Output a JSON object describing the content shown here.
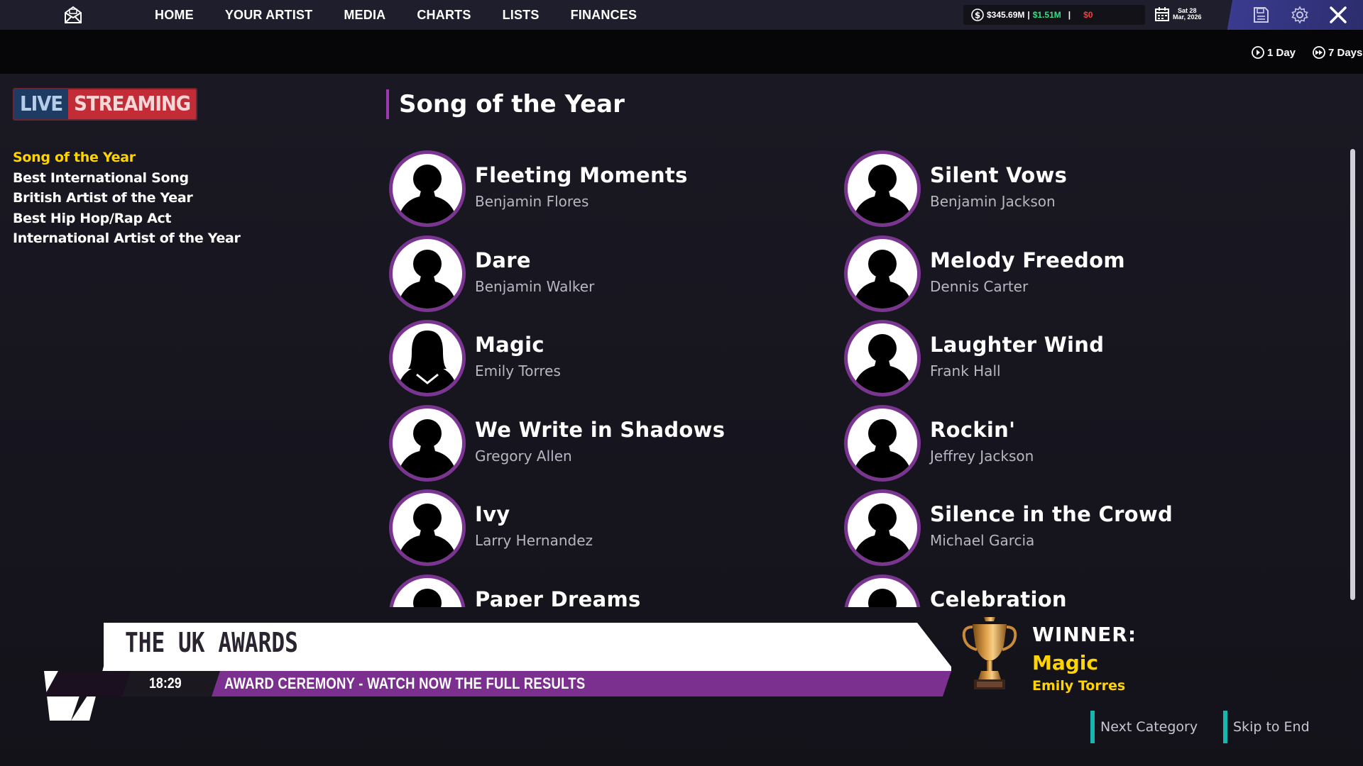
{
  "topbar": {
    "nav": [
      "HOME",
      "YOUR ARTIST",
      "MEDIA",
      "CHARTS",
      "LISTS",
      "FINANCES"
    ],
    "money": {
      "cash": "$345.69M",
      "income": "$1.51M",
      "expense": "$0"
    },
    "date": {
      "line1": "Sat 28",
      "line2": "Mar, 2026"
    }
  },
  "time_controls": {
    "one_day": "1 Day",
    "seven_days": "7 Days"
  },
  "logo": {
    "live": "LIVE",
    "streaming": "STREAMING"
  },
  "categories": [
    "Song of the Year",
    "Best International Song",
    "British Artist of the Year",
    "Best Hip Hop/Rap Act",
    "International Artist of the Year"
  ],
  "active_category_index": 0,
  "section_title": "Song of the Year",
  "nominees": [
    {
      "title": "Fleeting Moments",
      "artist": "Benjamin Flores",
      "avatar": "male-silhouette-icon"
    },
    {
      "title": "Silent Vows",
      "artist": "Benjamin Jackson",
      "avatar": "male-silhouette-icon"
    },
    {
      "title": "Dare",
      "artist": "Benjamin Walker",
      "avatar": "male-silhouette-icon"
    },
    {
      "title": "Melody Freedom",
      "artist": "Dennis Carter",
      "avatar": "male-silhouette-icon"
    },
    {
      "title": "Magic",
      "artist": "Emily Torres",
      "avatar": "female-silhouette-icon"
    },
    {
      "title": "Laughter Wind",
      "artist": "Frank Hall",
      "avatar": "male-silhouette-icon"
    },
    {
      "title": "We Write in Shadows",
      "artist": "Gregory Allen",
      "avatar": "male-silhouette-icon"
    },
    {
      "title": "Rockin'",
      "artist": "Jeffrey Jackson",
      "avatar": "male-silhouette-icon"
    },
    {
      "title": "Ivy",
      "artist": "Larry Hernandez",
      "avatar": "male-silhouette-icon"
    },
    {
      "title": "Silence in the Crowd",
      "artist": "Michael Garcia",
      "avatar": "male-silhouette-icon"
    },
    {
      "title": "Paper Dreams",
      "artist": "",
      "avatar": "male-silhouette-icon"
    },
    {
      "title": "Celebration",
      "artist": "",
      "avatar": "male-silhouette-icon"
    }
  ],
  "ticker": {
    "title": "THE UK AWARDS",
    "time": "18:29",
    "text": "AWARD CEREMONY - WATCH NOW THE FULL RESULTS"
  },
  "winner": {
    "label": "WINNER:",
    "song": "Magic",
    "artist": "Emily Torres"
  },
  "buttons": {
    "next": "Next Category",
    "skip": "Skip to End"
  },
  "colors": {
    "accent_purple": "#7a3590",
    "active_category": "#ffd400",
    "winner_gold": "#ffd400",
    "button_accent": "#17b6b0",
    "income_green": "#3ddc84",
    "expense_red": "#ff3b3b"
  }
}
